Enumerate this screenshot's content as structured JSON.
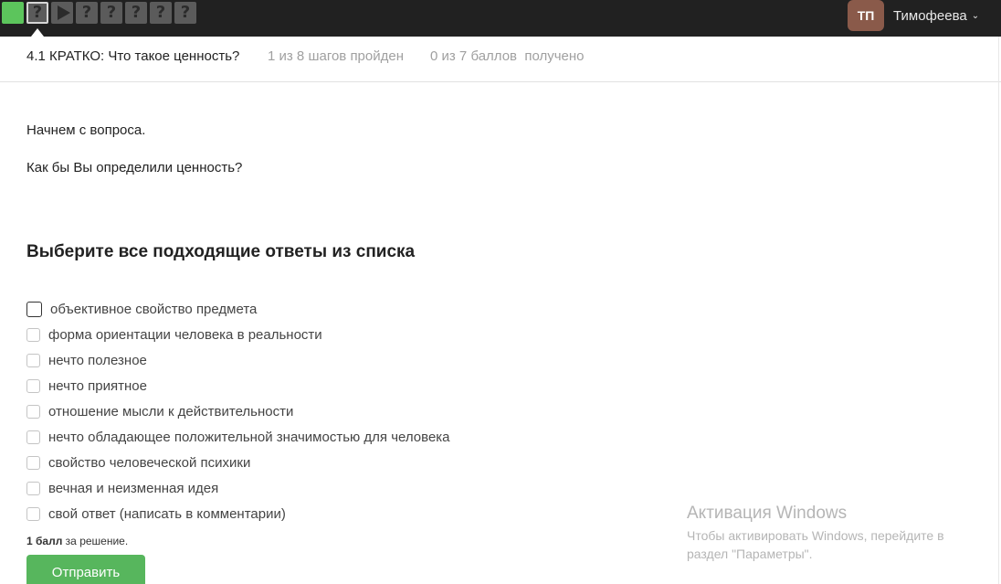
{
  "nav": {
    "steps": [
      {
        "state": "done",
        "glyph": ""
      },
      {
        "state": "active",
        "glyph": "?"
      },
      {
        "state": "video",
        "glyph": ""
      },
      {
        "state": "todo",
        "glyph": "?"
      },
      {
        "state": "todo",
        "glyph": "?"
      },
      {
        "state": "todo",
        "glyph": "?"
      },
      {
        "state": "todo",
        "glyph": "?"
      },
      {
        "state": "todo",
        "glyph": "?"
      }
    ],
    "user": {
      "initials": "ТП",
      "name": "Тимофеева"
    }
  },
  "header": {
    "title": "4.1 КРАТКО: Что такое ценность?",
    "progress": "1 из 8 шагов пройден",
    "score": "0 из 7 баллов  получено"
  },
  "content": {
    "intro": "Начнем с вопроса.",
    "question": "Как бы Вы определили ценность?",
    "instruction": "Выберите все подходящие ответы из списка",
    "options": [
      "объективное свойство предмета",
      "форма ориентации человека в реальности",
      "нечто полезное",
      "нечто приятное",
      "отношение мысли к действительности",
      "нечто обладающее положительной значимостью для человека",
      "свойство человеческой психики",
      "вечная и неизменная идея",
      "свой ответ (написать в комментарии)"
    ],
    "points_bold": "1 балл",
    "points_rest": " за решение.",
    "submit_label": "Отправить"
  },
  "watermark": {
    "title": "Активация Windows",
    "text": "Чтобы активировать Windows, перейдите в раздел \"Параметры\"."
  },
  "colors": {
    "topbar": "#212121",
    "step_done": "#5cc55c",
    "step_todo": "#5b5b5b",
    "avatar": "#8a5a4a",
    "submit": "#57b65d"
  }
}
